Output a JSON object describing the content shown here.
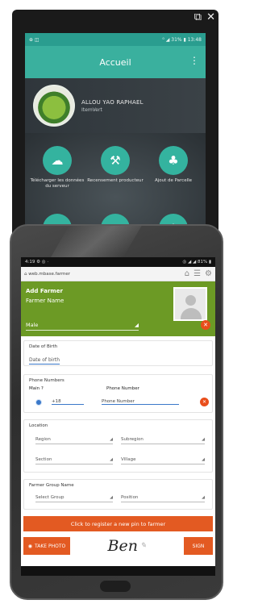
{
  "window": {
    "icon_names": [
      "external-window-icon",
      "close-icon"
    ],
    "close_glyph": "✕",
    "pop_glyph": "⧉"
  },
  "back_app": {
    "status_left": "⊕ ◫",
    "status_right": "⁰ ◢ 31% ▮ 13:48",
    "title": "Accueil",
    "menu_glyph": "⋮",
    "user_name": "ALLOU YAO RAPHAEL",
    "user_org": "ItemVert",
    "tiles": [
      {
        "label": "Télécharger les données du serveur",
        "icon": "cloud-download-icon"
      },
      {
        "label": "Recensement producteur",
        "icon": "farmer-icon"
      },
      {
        "label": "Ajout de Parcelle",
        "icon": "field-icon"
      },
      {
        "label": "",
        "icon": "cloud-upload-icon"
      },
      {
        "label": "",
        "icon": "form-icon"
      },
      {
        "label": "",
        "icon": "tree-icon"
      }
    ]
  },
  "front_app": {
    "status_left": "4:19 ⚙ ◎ ·",
    "status_right": "◎ ◢ ◢ 81% ▮",
    "url": "⌂ web.mbase.farmer",
    "header": {
      "title": "Add Farmer",
      "name": "Farmer Name",
      "gender": "Male"
    },
    "card_birth": {
      "label": "Date of Birth",
      "value": "Date of birth"
    },
    "card_phone": {
      "label": "Phone Numbers",
      "main_label": "Main ?",
      "number_label": "Phone Number",
      "prefix": "+18",
      "number_value": "Phone Number"
    },
    "card_location": {
      "label": "Location",
      "fields": [
        "Region",
        "Subregion",
        "Section",
        "Village"
      ]
    },
    "card_group": {
      "label": "Farmer Group Name",
      "fields": [
        "Select Group",
        "Position"
      ]
    },
    "action_button": "Click to register a new pin to farmer",
    "photo_button": "TAKE PHOTO",
    "signature": "Ben",
    "sign_button": "SIGN"
  },
  "colors": {
    "teal": "#3ab09e",
    "green": "#6c9a25",
    "orange": "#e35a22",
    "blue": "#3a78c9"
  }
}
